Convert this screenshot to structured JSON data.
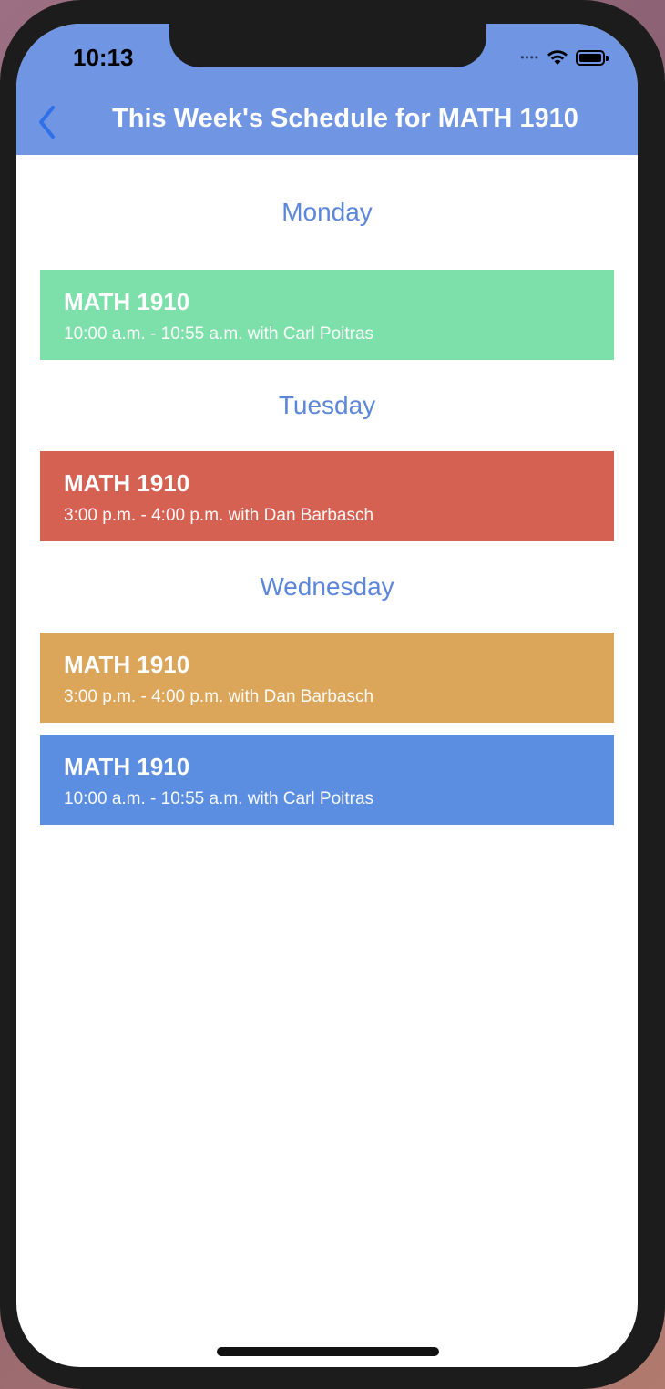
{
  "status_bar": {
    "time": "10:13"
  },
  "nav": {
    "title": "This Week's Schedule for MATH 1910",
    "back_icon": "chevron-left-icon"
  },
  "colors": {
    "nav_background": "#6f95e3",
    "day_header": "#5b86d9",
    "card_green": "#7de0aa",
    "card_red": "#d56152",
    "card_orange": "#dba55a",
    "card_blue": "#5b8de1"
  },
  "days": [
    {
      "name": "Monday",
      "classes": [
        {
          "title": "MATH 1910",
          "detail": "10:00 a.m. - 10:55 a.m. with Carl Poitras",
          "color": "#7de0aa"
        }
      ]
    },
    {
      "name": "Tuesday",
      "classes": [
        {
          "title": "MATH 1910",
          "detail": "3:00 p.m. - 4:00 p.m. with Dan Barbasch",
          "color": "#d56152"
        }
      ]
    },
    {
      "name": "Wednesday",
      "classes": [
        {
          "title": "MATH 1910",
          "detail": "3:00 p.m. - 4:00 p.m. with Dan Barbasch",
          "color": "#dba55a"
        },
        {
          "title": "MATH 1910",
          "detail": "10:00 a.m. - 10:55 a.m. with Carl Poitras",
          "color": "#5b8de1"
        }
      ]
    }
  ]
}
